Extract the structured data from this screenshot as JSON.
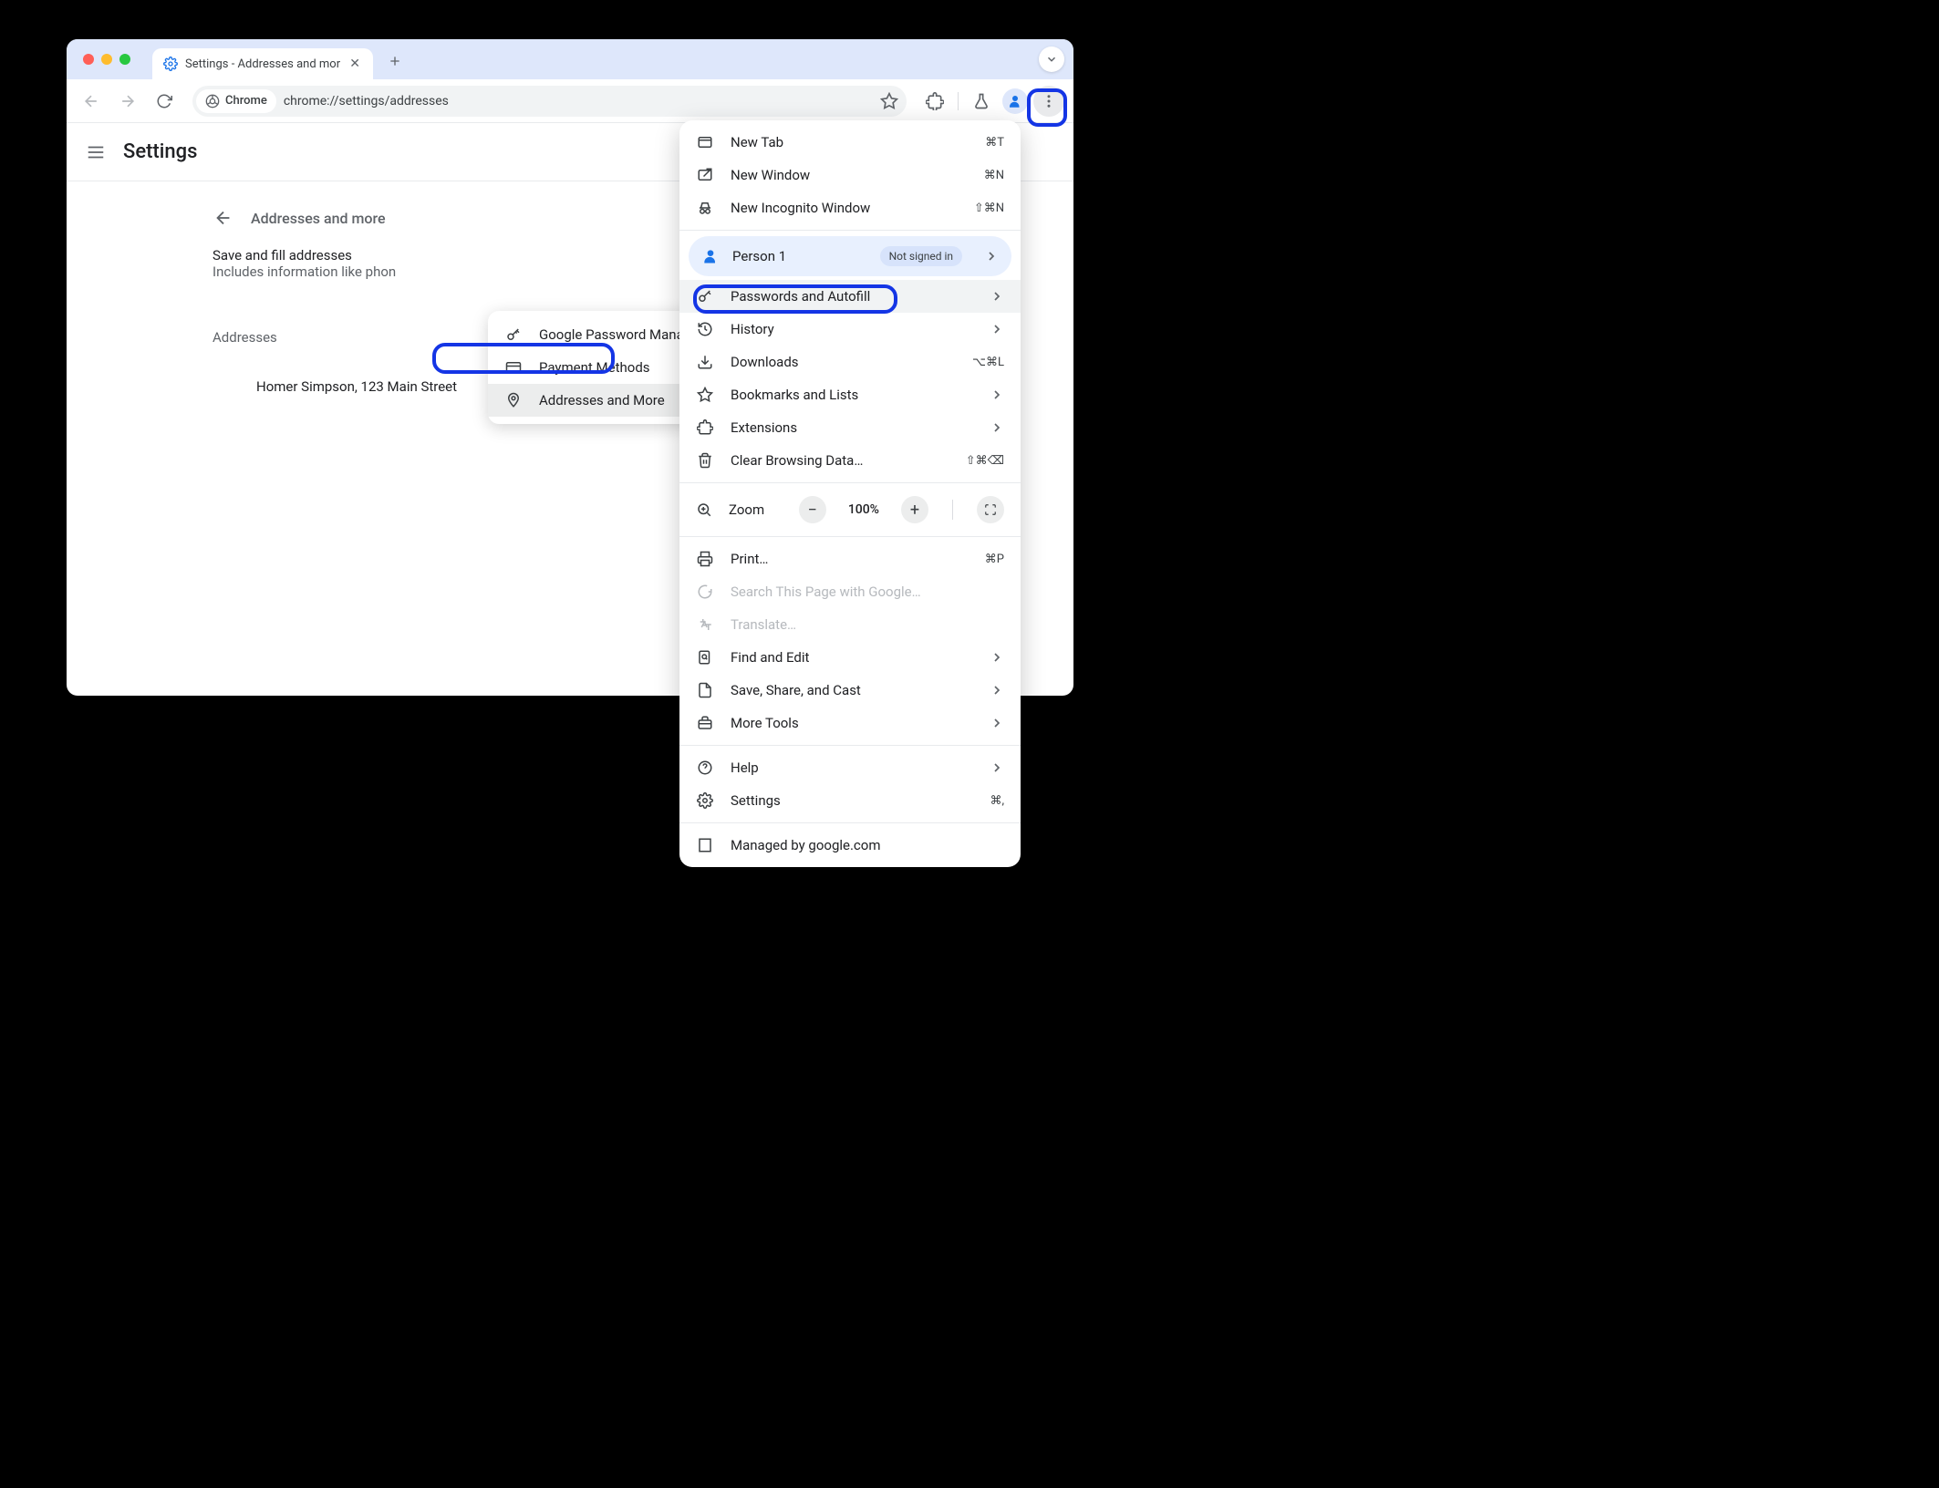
{
  "tab": {
    "title": "Settings - Addresses and mor"
  },
  "omnibox": {
    "chip": "Chrome",
    "url": "chrome://settings/addresses"
  },
  "header": {
    "title": "Settings"
  },
  "section": {
    "label": "Addresses and more",
    "row_title": "Save and fill addresses",
    "row_sub": "Includes information like phon",
    "addresses_label": "Addresses",
    "entry": "Homer Simpson, 123 Main Street"
  },
  "submenu": {
    "items": [
      {
        "label": "Google Password Manager"
      },
      {
        "label": "Payment Methods"
      },
      {
        "label": "Addresses and More"
      }
    ]
  },
  "menu": {
    "new_tab": {
      "label": "New Tab",
      "shortcut": "⌘T"
    },
    "new_window": {
      "label": "New Window",
      "shortcut": "⌘N"
    },
    "new_incognito": {
      "label": "New Incognito Window",
      "shortcut": "⇧⌘N"
    },
    "profile": {
      "name": "Person 1",
      "badge": "Not signed in"
    },
    "passwords": {
      "label": "Passwords and Autofill"
    },
    "history": {
      "label": "History"
    },
    "downloads": {
      "label": "Downloads",
      "shortcut": "⌥⌘L"
    },
    "bookmarks": {
      "label": "Bookmarks and Lists"
    },
    "extensions": {
      "label": "Extensions"
    },
    "clear": {
      "label": "Clear Browsing Data…",
      "shortcut": "⇧⌘⌫"
    },
    "zoom": {
      "label": "Zoom",
      "value": "100%"
    },
    "print": {
      "label": "Print…",
      "shortcut": "⌘P"
    },
    "search_page": {
      "label": "Search This Page with Google…"
    },
    "translate": {
      "label": "Translate…"
    },
    "find": {
      "label": "Find and Edit"
    },
    "save_share": {
      "label": "Save, Share, and Cast"
    },
    "more_tools": {
      "label": "More Tools"
    },
    "help": {
      "label": "Help"
    },
    "settings": {
      "label": "Settings",
      "shortcut": "⌘,"
    },
    "managed": {
      "label": "Managed by google.com"
    }
  }
}
